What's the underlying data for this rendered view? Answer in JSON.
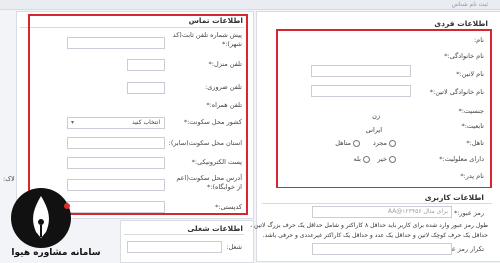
{
  "page": {
    "top_strip_title": "ثبت نام شناس"
  },
  "contact": {
    "title": "اطلاعات تماس",
    "fields": [
      {
        "label": "پیش شماره تلفن ثابت(کد شهر):*",
        "placeholder": ""
      },
      {
        "label": "تلفن منزل:*",
        "placeholder": ""
      },
      {
        "label": "تلفن ضروری:",
        "placeholder": ""
      },
      {
        "label": "تلفن همراه:*",
        "placeholder": ""
      }
    ],
    "country_label": "کشور محل سکونت:*",
    "country_value": "انتخاب کنید",
    "province_label": "استان محل سکونت(سایر):",
    "postal_label": "پست الکترونیکی:*",
    "address_label": "آدرس محل سکونت(اعم از خوابگاه):*",
    "postcode_label": "کدپستی:*"
  },
  "job": {
    "title": "اطلاعات شغلی",
    "job_label": "شغل:"
  },
  "personal": {
    "title": "اطلاعات فردی",
    "name_label": "نام:",
    "family_label": "نام خانوادگی:*",
    "latin_name_label": "نام لاتین:*",
    "latin_family_label": "نام خانوادگی لاتین:*",
    "gender_label": "جنسیت:*",
    "gender_value": "زن",
    "nationality_label": "تابعیت:*",
    "nationality_value": "ایرانی",
    "marital_label": "تاهل:*",
    "marital_options": [
      "مجرد",
      "متاهل"
    ],
    "disability_label": "دارای معلولیت:*",
    "disability_options": [
      "خیر",
      "بله"
    ],
    "father_label": "نام پدر:*"
  },
  "user": {
    "title": "اطلاعات کاربری",
    "username_label": "رمز عبور:*",
    "username_placeholder": "برای مثال ۱۲۳۴۵۶@AA",
    "hint_line1": "طول رمز عبور وارد شده برای کاربر باید حداقل ۸ کاراکتر و شامل حداقل یک حرف بزرگ لاتین ،",
    "hint_line2": "حداقل یک حرف کوچک لاتین و حداقل یک عدد و حداقل یک کاراکتر غیرعددی و حرفی باشد.",
    "repeat_label": "تکرار رمز عبور:*"
  },
  "left_edge": {
    "label": "لاک:"
  },
  "logo": {
    "line1": "سامانه مشاوره هیوا",
    "icon": "pen-nib-icon"
  },
  "colors": {
    "highlight": "#d6262f",
    "logo_circle": "#111111",
    "logo_accent": "#e02b2b"
  }
}
